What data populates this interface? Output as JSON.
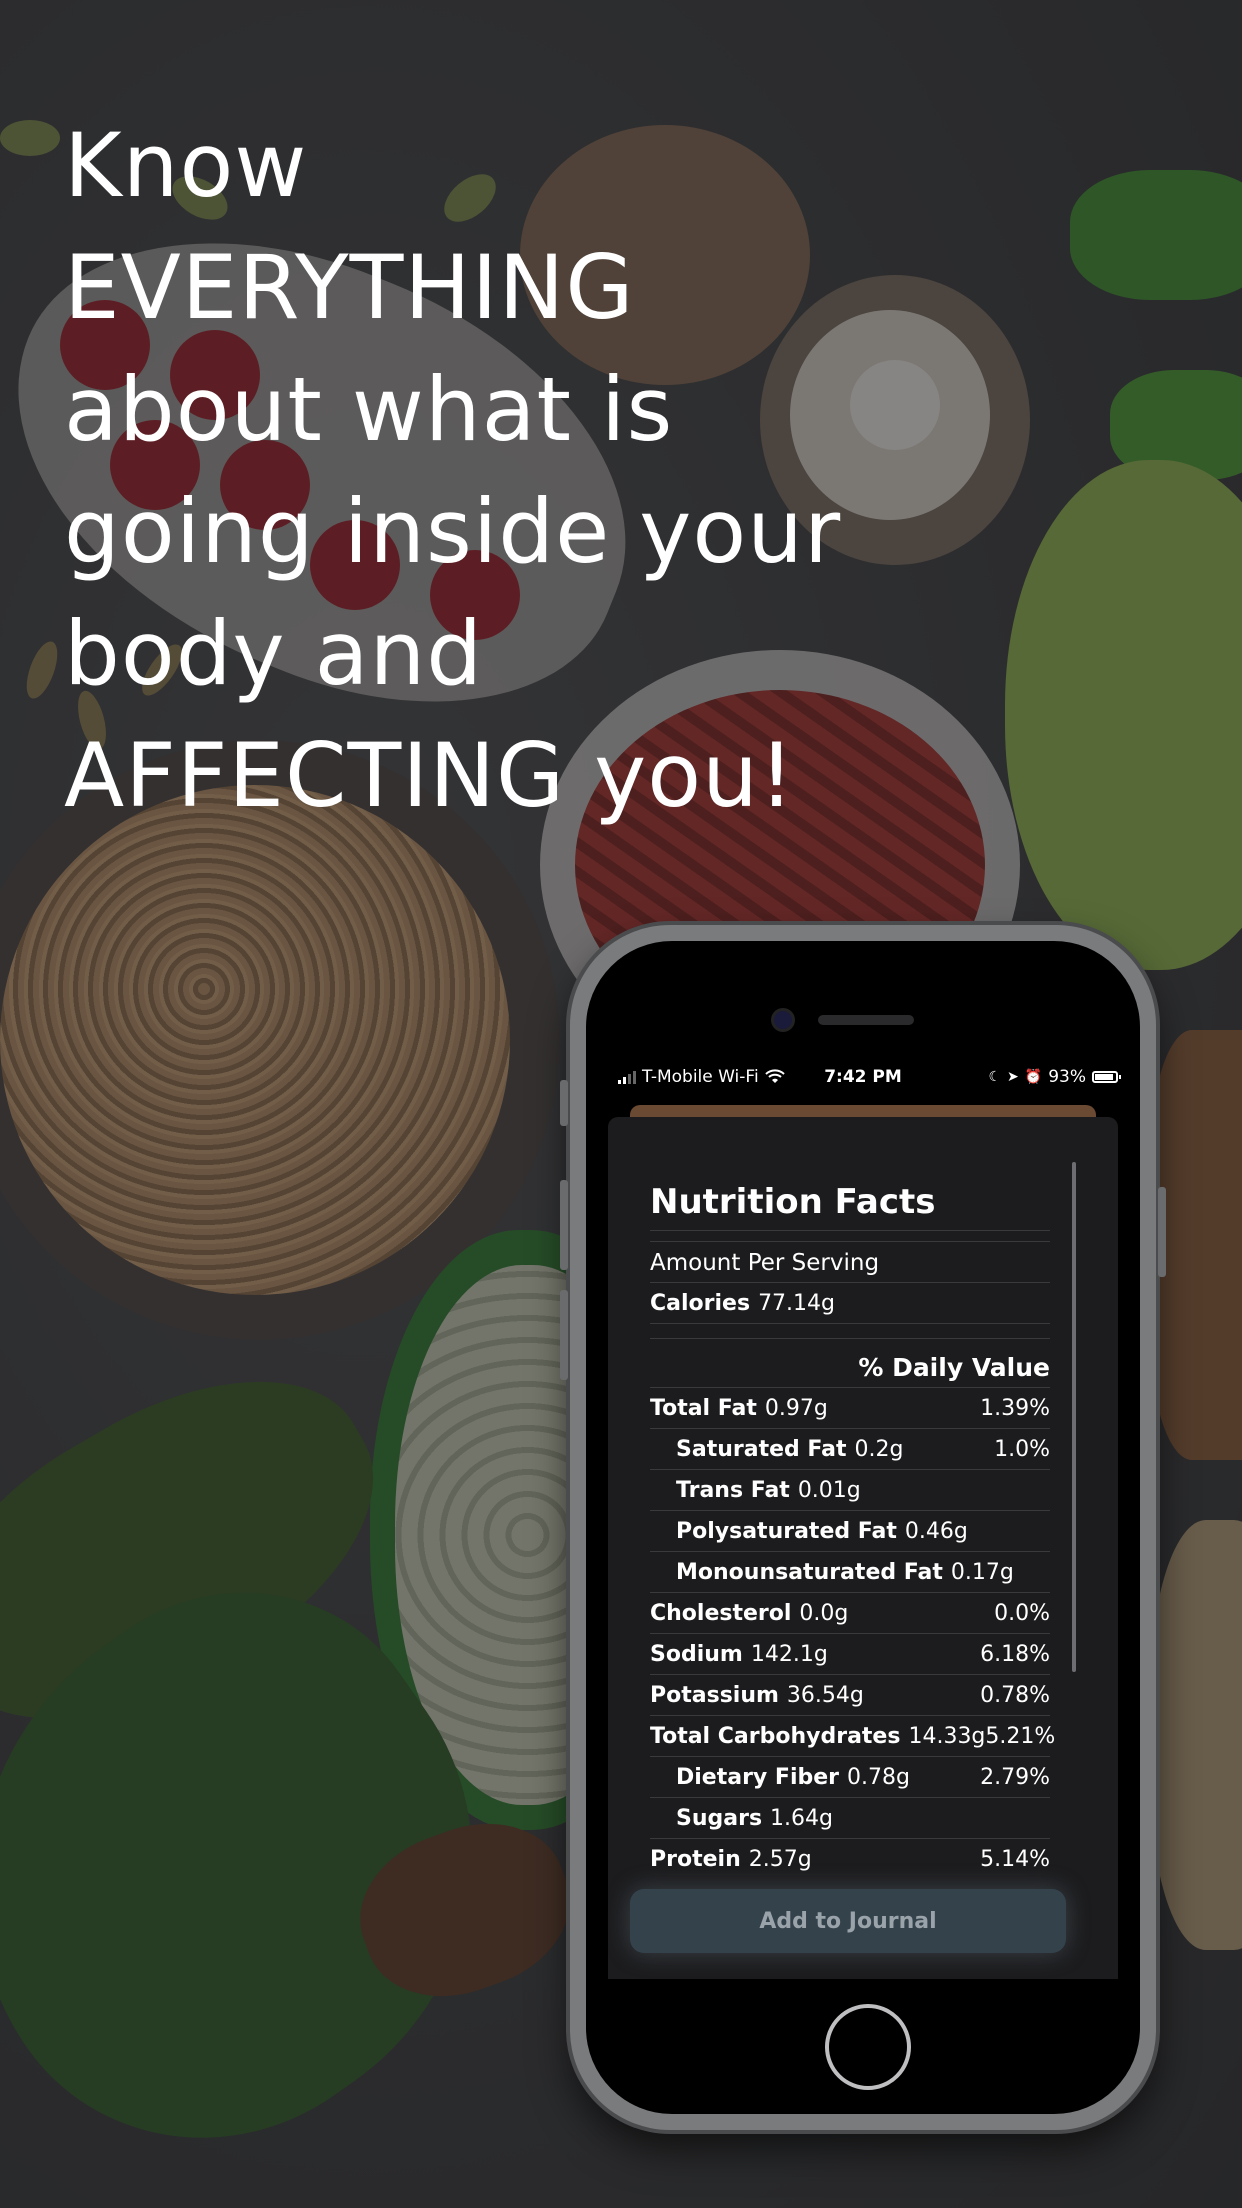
{
  "headline": {
    "lines": [
      "Know",
      "EVERYTHING",
      "about what is",
      "going inside your",
      "body and",
      "AFFECTING you!"
    ]
  },
  "status_bar": {
    "carrier": "T-Mobile Wi-Fi",
    "time": "7:42 PM",
    "battery": "93%"
  },
  "nutrition": {
    "title": "Nutrition Facts",
    "serving_label": "Amount Per Serving",
    "calories_label": "Calories",
    "calories_value": "77.14g",
    "daily_value_header": "% Daily Value",
    "rows": [
      {
        "label": "Total Fat",
        "amount": "0.97g",
        "dv": "1.39%"
      },
      {
        "label": "Saturated Fat",
        "amount": "0.2g",
        "dv": "1.0%"
      },
      {
        "label": "Trans Fat",
        "amount": "0.01g",
        "dv": ""
      },
      {
        "label": "Polysaturated Fat",
        "amount": "0.46g",
        "dv": ""
      },
      {
        "label": "Monounsaturated Fat",
        "amount": "0.17g",
        "dv": ""
      },
      {
        "label": "Cholesterol",
        "amount": "0.0g",
        "dv": "0.0%"
      },
      {
        "label": "Sodium",
        "amount": "142.1g",
        "dv": "6.18%"
      },
      {
        "label": "Potassium",
        "amount": "36.54g",
        "dv": "0.78%"
      },
      {
        "label": "Total Carbohydrates",
        "amount": "14.33g",
        "dv": "5.21%"
      },
      {
        "label": "Dietary Fiber",
        "amount": "0.78g",
        "dv": "2.79%"
      },
      {
        "label": "Sugars",
        "amount": "1.64g",
        "dv": ""
      },
      {
        "label": "Protein",
        "amount": "2.57g",
        "dv": "5.14%"
      }
    ]
  },
  "actions": {
    "add_label": "Add to Journal"
  },
  "colors": {
    "sheet": "#1c1c1e",
    "button": "#34424c",
    "button_text": "#9aa3a9"
  }
}
